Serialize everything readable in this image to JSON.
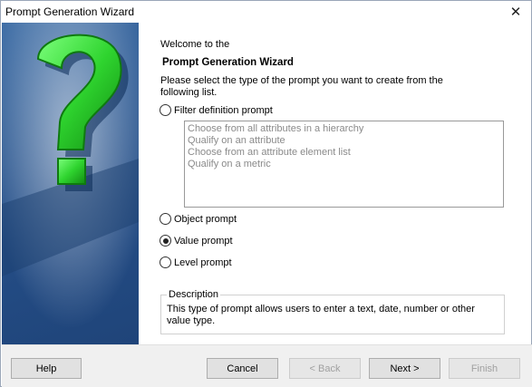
{
  "window": {
    "title": "Prompt Generation Wizard"
  },
  "content": {
    "welcome": "Welcome to the",
    "wizard_name": "Prompt Generation Wizard",
    "instructions": "Please select the type of the prompt you want to create from the following list.",
    "options": {
      "filter": {
        "label": "Filter definition prompt",
        "checked": false
      },
      "object": {
        "label": "Object prompt",
        "checked": false
      },
      "value": {
        "label": "Value prompt",
        "checked": true
      },
      "level": {
        "label": "Level prompt",
        "checked": false
      }
    },
    "filter_list": [
      "Choose from all attributes in a hierarchy",
      "Qualify on an attribute",
      "Choose from an attribute element list",
      "Qualify on a metric"
    ],
    "description": {
      "legend": "Description",
      "text": "This type of prompt allows users to enter a text, date, number or other value type."
    }
  },
  "buttons": {
    "help": "Help",
    "cancel": "Cancel",
    "back": "< Back",
    "next": "Next >",
    "finish": "Finish"
  },
  "colors": {
    "side_bg": "#2e5a93",
    "question_mark": "#3bd13b"
  },
  "icons": {
    "close": "close-icon",
    "side": "question-mark-icon"
  }
}
